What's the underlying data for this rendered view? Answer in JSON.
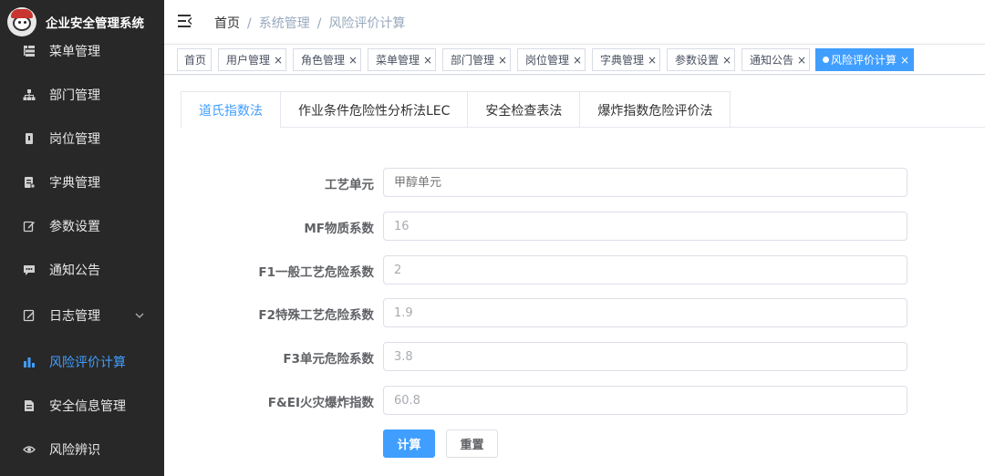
{
  "app": {
    "title": "企业安全管理系统"
  },
  "sidebar": {
    "items": [
      {
        "label": "菜单管理",
        "icon": "tree-table-icon"
      },
      {
        "label": "部门管理",
        "icon": "org-tree-icon"
      },
      {
        "label": "岗位管理",
        "icon": "post-icon"
      },
      {
        "label": "字典管理",
        "icon": "dict-icon"
      },
      {
        "label": "参数设置",
        "icon": "edit-icon"
      },
      {
        "label": "通知公告",
        "icon": "message-icon"
      },
      {
        "label": "日志管理",
        "icon": "log-icon",
        "expandable": true
      },
      {
        "label": "风险评价计算",
        "icon": "bar-chart-icon",
        "active": true
      },
      {
        "label": "安全信息管理",
        "icon": "document-icon"
      },
      {
        "label": "风险辨识",
        "icon": "eye-icon"
      }
    ]
  },
  "breadcrumb": {
    "items": [
      "首页",
      "系统管理",
      "风险评价计算"
    ],
    "separator": "/"
  },
  "tags": {
    "items": [
      {
        "label": "首页",
        "closable": false
      },
      {
        "label": "用户管理",
        "closable": true
      },
      {
        "label": "角色管理",
        "closable": true
      },
      {
        "label": "菜单管理",
        "closable": true
      },
      {
        "label": "部门管理",
        "closable": true
      },
      {
        "label": "岗位管理",
        "closable": true
      },
      {
        "label": "字典管理",
        "closable": true
      },
      {
        "label": "参数设置",
        "closable": true
      },
      {
        "label": "通知公告",
        "closable": true
      },
      {
        "label": "风险评价计算",
        "closable": true,
        "active": true
      }
    ],
    "close_glyph": "×"
  },
  "tabs": {
    "items": [
      {
        "label": "道氏指数法",
        "active": true
      },
      {
        "label": "作业条件危险性分析法LEC"
      },
      {
        "label": "安全检查表法"
      },
      {
        "label": "爆炸指数危险评价法"
      }
    ]
  },
  "form": {
    "fields": [
      {
        "label": "工艺单元",
        "value": "",
        "placeholder": "甲醇单元"
      },
      {
        "label": "MF物质系数",
        "value": "16"
      },
      {
        "label": "F1一般工艺危险系数",
        "value": "2"
      },
      {
        "label": "F2特殊工艺危险系数",
        "value": "1.9"
      },
      {
        "label": "F3单元危险系数",
        "value": "3.8"
      },
      {
        "label": "F&EI火灾爆炸指数",
        "value": "60.8"
      }
    ],
    "submit_label": "计算",
    "reset_label": "重置"
  },
  "colors": {
    "sidebar_bg": "#282828",
    "accent": "#409eff",
    "text_primary": "#303133",
    "text_secondary": "#606266"
  }
}
